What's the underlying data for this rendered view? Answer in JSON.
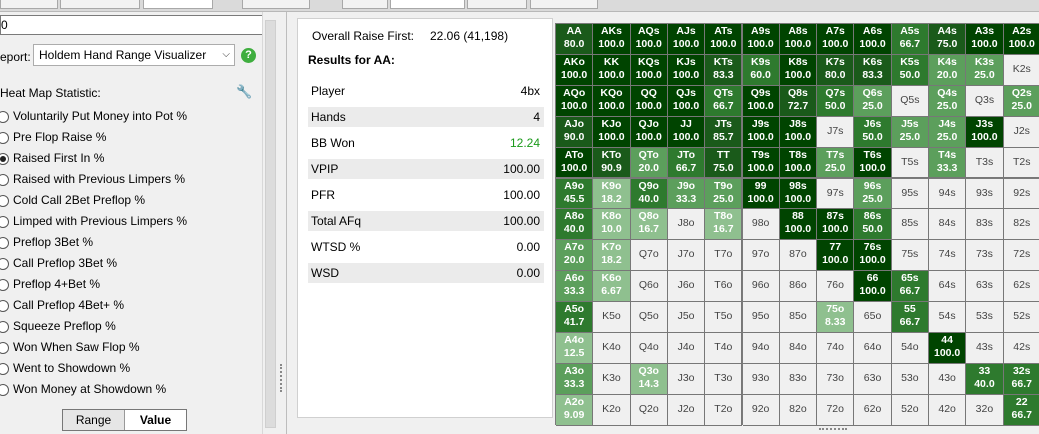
{
  "left": {
    "search_value": "0",
    "report_label": "eport:",
    "report_selected": "Holdem Hand Range Visualizer",
    "heatmap_title": "Heat Map Statistic:",
    "radio_items": [
      {
        "label": "Voluntarily Put Money into Pot %",
        "selected": false
      },
      {
        "label": "Pre Flop Raise %",
        "selected": false
      },
      {
        "label": "Raised First In %",
        "selected": true
      },
      {
        "label": "Raised with Previous Limpers %",
        "selected": false
      },
      {
        "label": "Cold Call 2Bet Preflop %",
        "selected": false
      },
      {
        "label": "Limped with Previous Limpers %",
        "selected": false
      },
      {
        "label": "Preflop 3Bet %",
        "selected": false
      },
      {
        "label": "Call Preflop 3Bet %",
        "selected": false
      },
      {
        "label": "Preflop 4+Bet %",
        "selected": false
      },
      {
        "label": "Call Preflop 4Bet+ %",
        "selected": false
      },
      {
        "label": "Squeeze Preflop %",
        "selected": false
      },
      {
        "label": "Won When Saw Flop %",
        "selected": false
      },
      {
        "label": "Went to Showdown %",
        "selected": false
      },
      {
        "label": "Won Money at Showdown %",
        "selected": false
      }
    ],
    "toggle_range": "Range",
    "toggle_value": "Value"
  },
  "stats": {
    "overall_label": "Overall Raise First:",
    "overall_value": "22.06 (41,198)",
    "results_title": "Results for AA:",
    "rows": [
      {
        "label": "Player",
        "value": "4bx"
      },
      {
        "label": "Hands",
        "value": "4"
      },
      {
        "label": "BB Won",
        "value": "12.24"
      },
      {
        "label": "VPIP",
        "value": "100.00"
      },
      {
        "label": "PFR",
        "value": "100.00"
      },
      {
        "label": "Total AFq",
        "value": "100.00"
      },
      {
        "label": "WTSD %",
        "value": "0.00"
      },
      {
        "label": "WSD",
        "value": "0.00"
      }
    ],
    "bbwon_color": "#1a9a1a"
  },
  "grid": [
    [
      [
        "AA",
        "80.0"
      ],
      [
        "AKs",
        "100.0"
      ],
      [
        "AQs",
        "100.0"
      ],
      [
        "AJs",
        "100.0"
      ],
      [
        "ATs",
        "100.0"
      ],
      [
        "A9s",
        "100.0"
      ],
      [
        "A8s",
        "100.0"
      ],
      [
        "A7s",
        "100.0"
      ],
      [
        "A6s",
        "100.0"
      ],
      [
        "A5s",
        "66.7"
      ],
      [
        "A4s",
        "75.0"
      ],
      [
        "A3s",
        "100.0"
      ],
      [
        "A2s",
        "100.0"
      ]
    ],
    [
      [
        "AKo",
        "100.0"
      ],
      [
        "KK",
        "100.0"
      ],
      [
        "KQs",
        "100.0"
      ],
      [
        "KJs",
        "100.0"
      ],
      [
        "KTs",
        "83.3"
      ],
      [
        "K9s",
        "60.0"
      ],
      [
        "K8s",
        "100.0"
      ],
      [
        "K7s",
        "80.0"
      ],
      [
        "K6s",
        "83.3"
      ],
      [
        "K5s",
        "50.0"
      ],
      [
        "K4s",
        "20.0"
      ],
      [
        "K3s",
        "25.0"
      ],
      [
        "K2s",
        ""
      ]
    ],
    [
      [
        "AQo",
        "100.0"
      ],
      [
        "KQo",
        "100.0"
      ],
      [
        "QQ",
        "100.0"
      ],
      [
        "QJs",
        "100.0"
      ],
      [
        "QTs",
        "66.7"
      ],
      [
        "Q9s",
        "100.0"
      ],
      [
        "Q8s",
        "72.7"
      ],
      [
        "Q7s",
        "50.0"
      ],
      [
        "Q6s",
        "25.0"
      ],
      [
        "Q5s",
        ""
      ],
      [
        "Q4s",
        "25.0"
      ],
      [
        "Q3s",
        ""
      ],
      [
        "Q2s",
        "25.0"
      ]
    ],
    [
      [
        "AJo",
        "90.0"
      ],
      [
        "KJo",
        "100.0"
      ],
      [
        "QJo",
        "100.0"
      ],
      [
        "JJ",
        "100.0"
      ],
      [
        "JTs",
        "85.7"
      ],
      [
        "J9s",
        "100.0"
      ],
      [
        "J8s",
        "100.0"
      ],
      [
        "J7s",
        ""
      ],
      [
        "J6s",
        "50.0"
      ],
      [
        "J5s",
        "25.0"
      ],
      [
        "J4s",
        "25.0"
      ],
      [
        "J3s",
        "100.0"
      ],
      [
        "J2s",
        ""
      ]
    ],
    [
      [
        "ATo",
        "100.0"
      ],
      [
        "KTo",
        "90.9"
      ],
      [
        "QTo",
        "20.0"
      ],
      [
        "JTo",
        "66.7"
      ],
      [
        "TT",
        "75.0"
      ],
      [
        "T9s",
        "100.0"
      ],
      [
        "T8s",
        "100.0"
      ],
      [
        "T7s",
        "25.0"
      ],
      [
        "T6s",
        "100.0"
      ],
      [
        "T5s",
        ""
      ],
      [
        "T4s",
        "33.3"
      ],
      [
        "T3s",
        ""
      ],
      [
        "T2s",
        ""
      ]
    ],
    [
      [
        "A9o",
        "45.5"
      ],
      [
        "K9o",
        "18.2"
      ],
      [
        "Q9o",
        "40.0"
      ],
      [
        "J9o",
        "33.3"
      ],
      [
        "T9o",
        "25.0"
      ],
      [
        "99",
        "100.0"
      ],
      [
        "98s",
        "100.0"
      ],
      [
        "97s",
        ""
      ],
      [
        "96s",
        "25.0"
      ],
      [
        "95s",
        ""
      ],
      [
        "94s",
        ""
      ],
      [
        "93s",
        ""
      ],
      [
        "92s",
        ""
      ]
    ],
    [
      [
        "A8o",
        "40.0"
      ],
      [
        "K8o",
        "10.0"
      ],
      [
        "Q8o",
        "16.7"
      ],
      [
        "J8o",
        ""
      ],
      [
        "T8o",
        "16.7"
      ],
      [
        "98o",
        ""
      ],
      [
        "88",
        "100.0"
      ],
      [
        "87s",
        "100.0"
      ],
      [
        "86s",
        "50.0"
      ],
      [
        "85s",
        ""
      ],
      [
        "84s",
        ""
      ],
      [
        "83s",
        ""
      ],
      [
        "82s",
        ""
      ]
    ],
    [
      [
        "A7o",
        "20.0"
      ],
      [
        "K7o",
        "18.2"
      ],
      [
        "Q7o",
        ""
      ],
      [
        "J7o",
        ""
      ],
      [
        "T7o",
        ""
      ],
      [
        "97o",
        ""
      ],
      [
        "87o",
        ""
      ],
      [
        "77",
        "100.0"
      ],
      [
        "76s",
        "100.0"
      ],
      [
        "75s",
        ""
      ],
      [
        "74s",
        ""
      ],
      [
        "73s",
        ""
      ],
      [
        "72s",
        ""
      ]
    ],
    [
      [
        "A6o",
        "33.3"
      ],
      [
        "K6o",
        "6.67"
      ],
      [
        "Q6o",
        ""
      ],
      [
        "J6o",
        ""
      ],
      [
        "T6o",
        ""
      ],
      [
        "96o",
        ""
      ],
      [
        "86o",
        ""
      ],
      [
        "76o",
        ""
      ],
      [
        "66",
        "100.0"
      ],
      [
        "65s",
        "66.7"
      ],
      [
        "64s",
        ""
      ],
      [
        "63s",
        ""
      ],
      [
        "62s",
        ""
      ]
    ],
    [
      [
        "A5o",
        "41.7"
      ],
      [
        "K5o",
        ""
      ],
      [
        "Q5o",
        ""
      ],
      [
        "J5o",
        ""
      ],
      [
        "T5o",
        ""
      ],
      [
        "95o",
        ""
      ],
      [
        "85o",
        ""
      ],
      [
        "75o",
        "8.33"
      ],
      [
        "65o",
        ""
      ],
      [
        "55",
        "66.7"
      ],
      [
        "54s",
        ""
      ],
      [
        "53s",
        ""
      ],
      [
        "52s",
        ""
      ]
    ],
    [
      [
        "A4o",
        "12.5"
      ],
      [
        "K4o",
        ""
      ],
      [
        "Q4o",
        ""
      ],
      [
        "J4o",
        ""
      ],
      [
        "T4o",
        ""
      ],
      [
        "94o",
        ""
      ],
      [
        "84o",
        ""
      ],
      [
        "74o",
        ""
      ],
      [
        "64o",
        ""
      ],
      [
        "54o",
        ""
      ],
      [
        "44",
        "100.0"
      ],
      [
        "43s",
        ""
      ],
      [
        "42s",
        ""
      ]
    ],
    [
      [
        "A3o",
        "33.3"
      ],
      [
        "K3o",
        ""
      ],
      [
        "Q3o",
        "14.3"
      ],
      [
        "J3o",
        ""
      ],
      [
        "T3o",
        ""
      ],
      [
        "93o",
        ""
      ],
      [
        "83o",
        ""
      ],
      [
        "73o",
        ""
      ],
      [
        "63o",
        ""
      ],
      [
        "53o",
        ""
      ],
      [
        "43o",
        ""
      ],
      [
        "33",
        "40.0"
      ],
      [
        "32s",
        "66.7"
      ]
    ],
    [
      [
        "A2o",
        "9.09"
      ],
      [
        "K2o",
        ""
      ],
      [
        "Q2o",
        ""
      ],
      [
        "J2o",
        ""
      ],
      [
        "T2o",
        ""
      ],
      [
        "92o",
        ""
      ],
      [
        "82o",
        ""
      ],
      [
        "72o",
        ""
      ],
      [
        "62o",
        ""
      ],
      [
        "52o",
        ""
      ],
      [
        "42o",
        ""
      ],
      [
        "32o",
        ""
      ],
      [
        "22",
        "66.7"
      ]
    ]
  ],
  "heat_colors": {
    "full": "#004400",
    "high": "#1a5a1a",
    "mid": "#2e7a2e",
    "low": "#5c9f5c",
    "lowest": "#8fc08f",
    "empty": "#f0f0f0"
  }
}
